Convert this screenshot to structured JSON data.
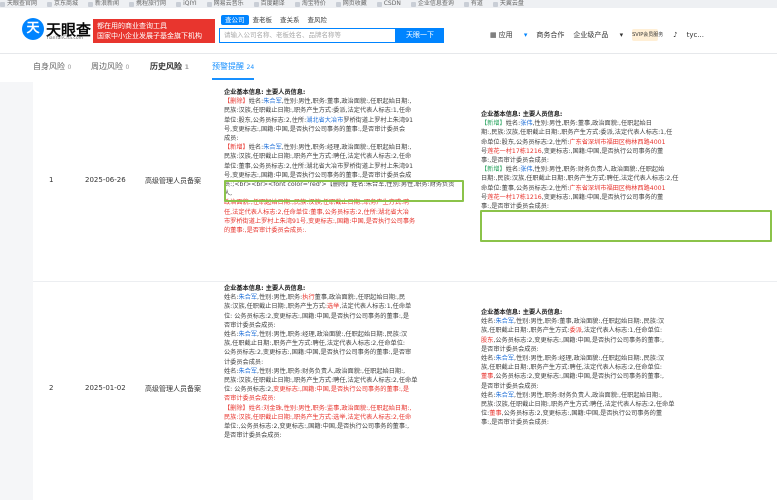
{
  "bookmarks": [
    "天眼查官网",
    "京东商城",
    "新浪新闻",
    "携程旅行网",
    "iQIYI",
    "网易云音乐",
    "百度翻译",
    "淘宝特价",
    "网页收藏",
    "CSDN",
    "企业信息查询",
    "有道",
    "天翼云盘"
  ],
  "header": {
    "logo_char": "天",
    "logo_text": "天眼查",
    "logo_sub": "TianYanCha.com",
    "tag_line1": "都在用的商业查询工具",
    "tag_line2": "国家中小企业发展子基金旗下机构",
    "search_tabs": [
      "查公司",
      "查老板",
      "查关系",
      "查风险"
    ],
    "search_placeholder": "请输入公司名称、老板姓名、品牌名称等",
    "search_button": "天眼一下",
    "nav": {
      "apps": "应用",
      "biz": "商务合作",
      "enterprise": "企业级产品",
      "vip": "SVIP会员服务",
      "user": "tyc..."
    }
  },
  "tabs": [
    {
      "label": "自身风险",
      "count": "0"
    },
    {
      "label": "周边风险",
      "count": "0"
    },
    {
      "label": "历史风险",
      "count": "1"
    },
    {
      "label": "预警提醒",
      "count": "24"
    }
  ],
  "rows": [
    {
      "index": "1",
      "date": "2025-06-26",
      "type": "高级管理人员备案",
      "col4": [
        {
          "cls": "hd",
          "t": "企业基本信息: 主要人员信息:"
        },
        {
          "cls": "",
          "h": "<span class='red'>【删除】</span>姓名:<span class='blue'>朱合军</span>,性别:男性,职务:董事,政治面貌:,任职起始日期:,"
        },
        {
          "cls": "",
          "t": "民族:汉族,任职截止日期:,职务产生方式:委派,法定代表人标志:1,任命"
        },
        {
          "cls": "",
          "h": "单位:股东,公务员标志:2,住所:<span class='blue'>湖北省大冶市</span>罗桥街道上罗村上朱湾91"
        },
        {
          "cls": "",
          "t": "号,变更标志:,国籍:中国,是否执行公司事务的董事:,是否审计委员会"
        },
        {
          "cls": "",
          "t": "成员:"
        },
        {
          "cls": "",
          "h": "<span class='red'>【新增】</span>姓名:<span class='blue'>朱合军</span>,性别:男性,职务:经理,政治面貌:,任职起始日期:,"
        },
        {
          "cls": "",
          "t": "民族:汉族,任职截止日期:,职务产生方式:聘任,法定代表人标志:2,任命"
        },
        {
          "cls": "",
          "t": "单位:董事,公务员标志:2,住所:湖北省大冶市罗桥街道上罗村上朱湾91"
        },
        {
          "cls": "",
          "t": "号,变更标志:,国籍:中国,是否执行公司事务的董事:,是否审计委员会成"
        },
        {
          "cls": "",
          "t": "员:;<br><br><font color='red'>【删除】姓名:朱合军,性别:男性,职务:财务负责人,"
        },
        {
          "cls": "red",
          "t": "政治面貌:,任职起始日期:,民族:汉族,任职截止日期:,职务产生方式:聘"
        },
        {
          "cls": "red",
          "t": "任,法定代表人标志:2,任命单位:董事,公务员标志:2,住所:湖北省大冶"
        },
        {
          "cls": "red",
          "t": "市罗桥街道上罗村上朱湾91号,变更标志:,国籍:中国,是否执行公司事务"
        },
        {
          "cls": "red",
          "t": "的董事:,是否审计委员会成员:."
        }
      ],
      "col5": [
        {
          "cls": "hd",
          "t": "企业基本信息: 主要人员信息:"
        },
        {
          "cls": "",
          "h": "<span class='green'>【新增】</span>姓名:<span class='blue'>张伟</span>,性别:男性,职务:董事,政治面貌:,任职起始日"
        },
        {
          "cls": "",
          "t": "期:,民族:汉族,任职截止日期:,职务产生方式:委派,法定代表人标志:1,任"
        },
        {
          "cls": "",
          "h": "命单位:股东,公务员标志:2,住所:<span class='orng'>广东省深圳市福田区梅林西路4001</span>"
        },
        {
          "cls": "",
          "h": "号<span class='orng'>莲花一村17栋1216</span>,变更标志:,国籍:中国,是否执行公司事务的董"
        },
        {
          "cls": "",
          "t": "事:,是否审计委员会成员:"
        },
        {
          "cls": "",
          "h": "<span class='green'>【新增】</span>姓名:<span class='blue'>张伟</span>,性别:男性,职务:财务负责人,政治面貌:,任职起始"
        },
        {
          "cls": "",
          "t": "日期:,民族:汉族,任职截止日期:,职务产生方式:聘任,法定代表人标志:2,任"
        },
        {
          "cls": "",
          "h": "命单位:董事,公务员标志:2,住所:<span class='orng'>广东省深圳市福田区梅林西路4001</span>"
        },
        {
          "cls": "",
          "h": "号<span class='orng'>莲花一村17栋1216</span>,变更标志:,国籍:中国,是否执行公司事务的董"
        },
        {
          "cls": "",
          "t": "事:,是否审计委员会成员:"
        }
      ]
    },
    {
      "index": "2",
      "date": "2025-01-02",
      "type": "高级管理人员备案",
      "col4": [
        {
          "cls": "hd",
          "t": "企业基本信息: 主要人员信息:"
        },
        {
          "cls": "",
          "h": "姓名:<span class='blue'>朱合军</span>,性别:男性,职务:<span class='red'>执行</span>董事,政治面貌:,任职起始日期:,民"
        },
        {
          "cls": "",
          "h": "族:汉族,任职截止日期:,职务产生方式:<span class='red'>选举</span>,法定代表人标志:1,任命单"
        },
        {
          "cls": "",
          "t": "位: 公务员标志:2,变更标志:,国籍:中国,是否执行公司事务的董事:,是"
        },
        {
          "cls": "",
          "t": "否审计委员会成员:"
        },
        {
          "cls": "",
          "h": "姓名:<span class='blue'>朱合军</span>,性别:男性,职务:经理,政治面貌:,任职起始日期:,民族:汉"
        },
        {
          "cls": "",
          "t": "族,任职截止日期:,职务产生方式:聘任,法定代表人标志:2,任命单位:"
        },
        {
          "cls": "",
          "t": "公务员标志:2,变更标志:,国籍:中国,是否执行公司事务的董事:,是否审"
        },
        {
          "cls": "",
          "t": "计委员会成员:"
        },
        {
          "cls": "",
          "h": "姓名:<span class='blue'>朱合军</span>,性别:男性,职务:财务负责人,政治面貌:,任职起始日期:,"
        },
        {
          "cls": "",
          "t": "民族:汉族,任职截止日期:,职务产生方式:聘任,法定代表人标志:2,任命单"
        },
        {
          "cls": "",
          "h": "位: 公务员标志:2,<span class='red'>变更标志:,国籍:中国,是否执行公司事务的董事:,是</span>"
        },
        {
          "cls": "red",
          "t": "否审计委员会成员:"
        },
        {
          "cls": "red",
          "t": "【删除】姓名:刘金珠,性别:男性,职务:监事,政治面貌:,任职起始日期:,"
        },
        {
          "cls": "red",
          "t": "民族:汉族,任职截止日期:,职务产生方式:选举,法定代表人标志:2,任命"
        },
        {
          "cls": "",
          "h": "单位:,公务员标志:2,变更标志:,国籍:中国,是否执行公司事务的董事:,"
        },
        {
          "cls": "",
          "t": "是否审计委员会成员:"
        }
      ],
      "col5": [
        {
          "cls": "hd",
          "t": "企业基本信息: 主要人员信息:"
        },
        {
          "cls": "",
          "h": "姓名:<span class='blue'>朱合军</span>,性别:男性,职务:董事,政治面貌:,任职起始日期:,民族:汉"
        },
        {
          "cls": "",
          "h": "族,任职截止日期:,职务产生方式:<span class='red'>委派</span>,法定代表人标志:1,任命单位:"
        },
        {
          "cls": "",
          "h": "<span class='red'>股东</span>,公务员标志:2,变更标志:,国籍:中国,是否执行公司事务的董事:,"
        },
        {
          "cls": "",
          "t": "是否审计委员会成员:"
        },
        {
          "cls": "",
          "h": "姓名:<span class='blue'>朱合军</span>,性别:男性,职务:经理,政治面貌:,任职起始日期:,民族:汉"
        },
        {
          "cls": "",
          "t": "族,任职截止日期:,职务产生方式:聘任,法定代表人标志:2,任命单位:"
        },
        {
          "cls": "",
          "h": "<span class='red'>董事</span>,公务员标志:2,变更标志:,国籍:中国,是否执行公司事务的董事:,"
        },
        {
          "cls": "",
          "t": "是否审计委员会成员:"
        },
        {
          "cls": "",
          "h": "姓名:<span class='blue'>朱合军</span>,性别:男性,职务:财务负责人,政治面貌:,任职起始日期:,"
        },
        {
          "cls": "",
          "t": "民族:汉族,任职截止日期:,职务产生方式:聘任,法定代表人标志:2,任命单"
        },
        {
          "cls": "",
          "h": "位:<span class='red'>董事</span>,公务员标志:2,变更标志:,国籍:中国,是否执行公司事务的董"
        },
        {
          "cls": "",
          "t": "事:,是否审计委员会成员:"
        }
      ]
    }
  ]
}
